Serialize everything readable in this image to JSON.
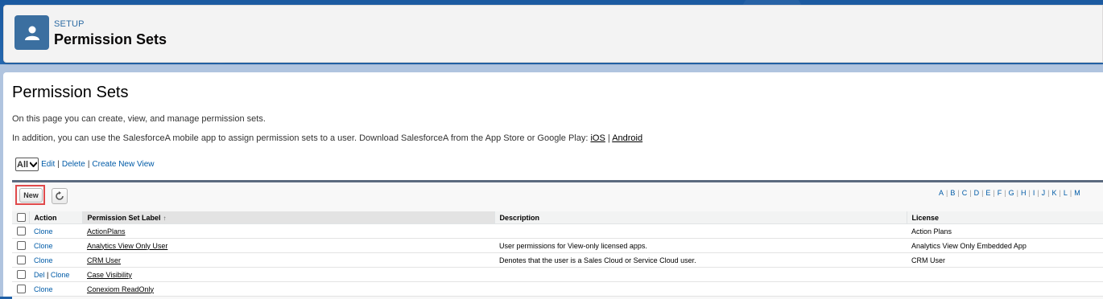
{
  "header": {
    "breadcrumb": "SETUP",
    "title": "Permission Sets"
  },
  "page": {
    "title": "Permission Sets",
    "intro": "On this page you can create, view, and manage permission sets.",
    "mobile_text": "In addition, you can use the SalesforceA mobile app to assign permission sets to a user. Download SalesforceA from the App Store or Google Play: ",
    "ios_link": "iOS",
    "android_link": "Android"
  },
  "view": {
    "selected": "All",
    "edit": "Edit",
    "delete": "Delete",
    "create": "Create New View"
  },
  "toolbar": {
    "new_label": "New"
  },
  "alphabet": [
    "A",
    "B",
    "C",
    "D",
    "E",
    "F",
    "G",
    "H",
    "I",
    "J",
    "K",
    "L",
    "M"
  ],
  "columns": {
    "action": "Action",
    "label": "Permission Set Label",
    "sort_indicator": "↑",
    "description": "Description",
    "license": "License"
  },
  "rows": [
    {
      "actions": [
        "Clone"
      ],
      "label": "ActionPlans",
      "description": "",
      "license": "Action Plans"
    },
    {
      "actions": [
        "Clone"
      ],
      "label": "Analytics View Only User",
      "description": "User permissions for View-only licensed apps.",
      "license": "Analytics View Only Embedded App"
    },
    {
      "actions": [
        "Clone"
      ],
      "label": "CRM User",
      "description": "Denotes that the user is a Sales Cloud or Service Cloud user.",
      "license": "CRM User"
    },
    {
      "actions": [
        "Del",
        "Clone"
      ],
      "label": "Case Visibility",
      "description": "",
      "license": ""
    },
    {
      "actions": [
        "Clone"
      ],
      "label": "Conexiom ReadOnly",
      "description": "",
      "license": ""
    }
  ],
  "colors": {
    "header_blue": "#1b5aa0",
    "link_blue": "#015ba7",
    "highlight_red": "#e0494b"
  }
}
